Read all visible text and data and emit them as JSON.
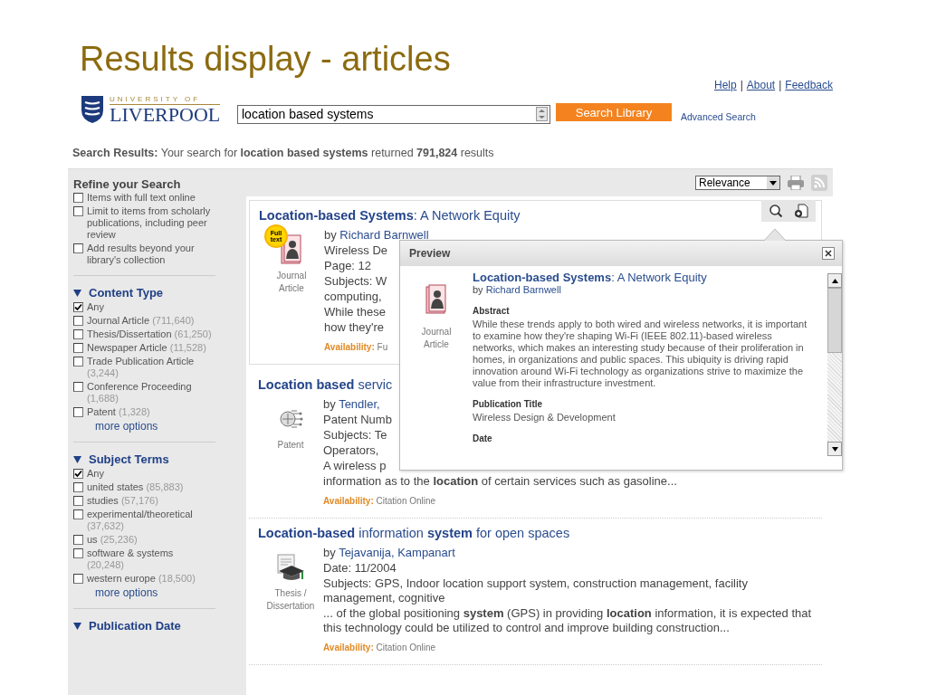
{
  "slide_title": "Results display - articles",
  "header": {
    "logo": {
      "line1": "UNIVERSITY OF",
      "line2": "LIVERPOOL"
    },
    "links": [
      "Help",
      "About",
      "Feedback"
    ],
    "link_separator": "|",
    "search": {
      "value": "location based systems"
    },
    "search_button": "Search Library",
    "advanced_link": "Advanced Search"
  },
  "summary": "**Search Results:** Your search for **location based systems** returned **791,824** results",
  "sort": {
    "value": "Relevance"
  },
  "refine": {
    "title": "Refine your Search",
    "options": [
      {
        "label": "Items with full text online",
        "checked": false
      },
      {
        "label": "Limit to items from scholarly publications, including peer review",
        "checked": false
      },
      {
        "label": "Add results beyond your library's collection",
        "checked": false
      }
    ]
  },
  "facets": [
    {
      "title": "Content Type",
      "expanded": true,
      "more": "more options",
      "items": [
        {
          "label": "Any",
          "checked": true
        },
        {
          "label": "Journal Article",
          "count": "(711,640)",
          "checked": false
        },
        {
          "label": "Thesis/Dissertation",
          "count": "(61,250)",
          "checked": false
        },
        {
          "label": "Newspaper Article",
          "count": "(11,528)",
          "checked": false
        },
        {
          "label": "Trade Publication Article",
          "count": "(3,244)",
          "checked": false
        },
        {
          "label": "Conference Proceeding",
          "count": "(1,688)",
          "checked": false
        },
        {
          "label": "Patent",
          "count": "(1,328)",
          "checked": false
        }
      ]
    },
    {
      "title": "Subject Terms",
      "expanded": true,
      "more": "more options",
      "items": [
        {
          "label": "Any",
          "checked": true
        },
        {
          "label": "united states",
          "count": "(85,883)",
          "checked": false
        },
        {
          "label": "studies",
          "count": "(57,176)",
          "checked": false
        },
        {
          "label": "experimental/theoretical",
          "count": "(37,632)",
          "checked": false
        },
        {
          "label": "us",
          "count": "(25,236)",
          "checked": false
        },
        {
          "label": "software & systems",
          "count": "(20,248)",
          "checked": false
        },
        {
          "label": "western europe",
          "count": "(18,500)",
          "checked": false
        }
      ]
    },
    {
      "title": "Publication Date",
      "expanded": true
    }
  ],
  "results": [
    {
      "title": "**Location-based Systems**: A Network Equity",
      "kind": "journal",
      "type_label": "Journal Article",
      "full_text": true,
      "badge": "Full text",
      "tools": true,
      "lines": [
        {
          "kind": "author",
          "prefix": "by",
          "name": "Richard Barnwell"
        },
        {
          "kind": "text",
          "text": "Wireless De"
        },
        {
          "kind": "text",
          "text": "Page: 12"
        },
        {
          "kind": "text",
          "text": "Subjects: W"
        },
        {
          "kind": "text",
          "text": "computing,"
        },
        {
          "kind": "text",
          "text": "While these"
        },
        {
          "kind": "text",
          "text": "how they're"
        }
      ],
      "availability_label": "Availability:",
      "availability": "Fu"
    },
    {
      "title": "**Location based** servic",
      "kind": "patent",
      "type_label": "Patent",
      "full_text": false,
      "tools": false,
      "lines": [
        {
          "kind": "author",
          "prefix": "by",
          "name": "Tendler,"
        },
        {
          "kind": "text",
          "text": "Patent Numb"
        },
        {
          "kind": "text",
          "text": "Subjects: Te"
        },
        {
          "kind": "text",
          "text": "Operators,"
        },
        {
          "kind": "text",
          "text": "A wireless p"
        },
        {
          "kind": "text",
          "text": "information as to the **location** of certain services such as gasoline..."
        }
      ],
      "availability_label": "Availability:",
      "availability": "Citation Online"
    },
    {
      "title": "**Location-based** information **system** for open spaces",
      "kind": "thesis",
      "type_label": "Thesis / Dissertation",
      "full_text": false,
      "tools": false,
      "lines": [
        {
          "kind": "author",
          "prefix": "by",
          "name": "Tejavanija, Kampanart"
        },
        {
          "kind": "text",
          "text": "Date: 11/2004"
        },
        {
          "kind": "text",
          "text": "Subjects: GPS, Indoor location support system, construction management, facility management, cognitive"
        },
        {
          "kind": "text",
          "text": "... of the global positioning **system** (GPS) in providing **location** information, it is expected that this technology could be utilized to control and improve building construction..."
        }
      ],
      "availability_label": "Availability:",
      "availability": "Citation Online"
    }
  ],
  "preview": {
    "title": "Preview",
    "article_title": "**Location-based Systems**: A Network Equity",
    "author_prefix": "by",
    "author": "Richard Barnwell",
    "kind": "journal",
    "type_label": "Journal Article",
    "sections": [
      {
        "heading": "Abstract",
        "text": "While these trends apply to both wired and wireless networks, it is important to examine how they're shaping Wi-Fi (IEEE 802.11)-based wireless networks, which makes an interesting study because of their proliferation in homes, in organizations and public spaces. This ubiquity is driving rapid innovation around Wi-Fi technology as organizations strive to maximize the value from their infrastructure investment."
      },
      {
        "heading": "Publication Title",
        "text": "Wireless Design & Development"
      },
      {
        "heading": "Date"
      }
    ]
  }
}
